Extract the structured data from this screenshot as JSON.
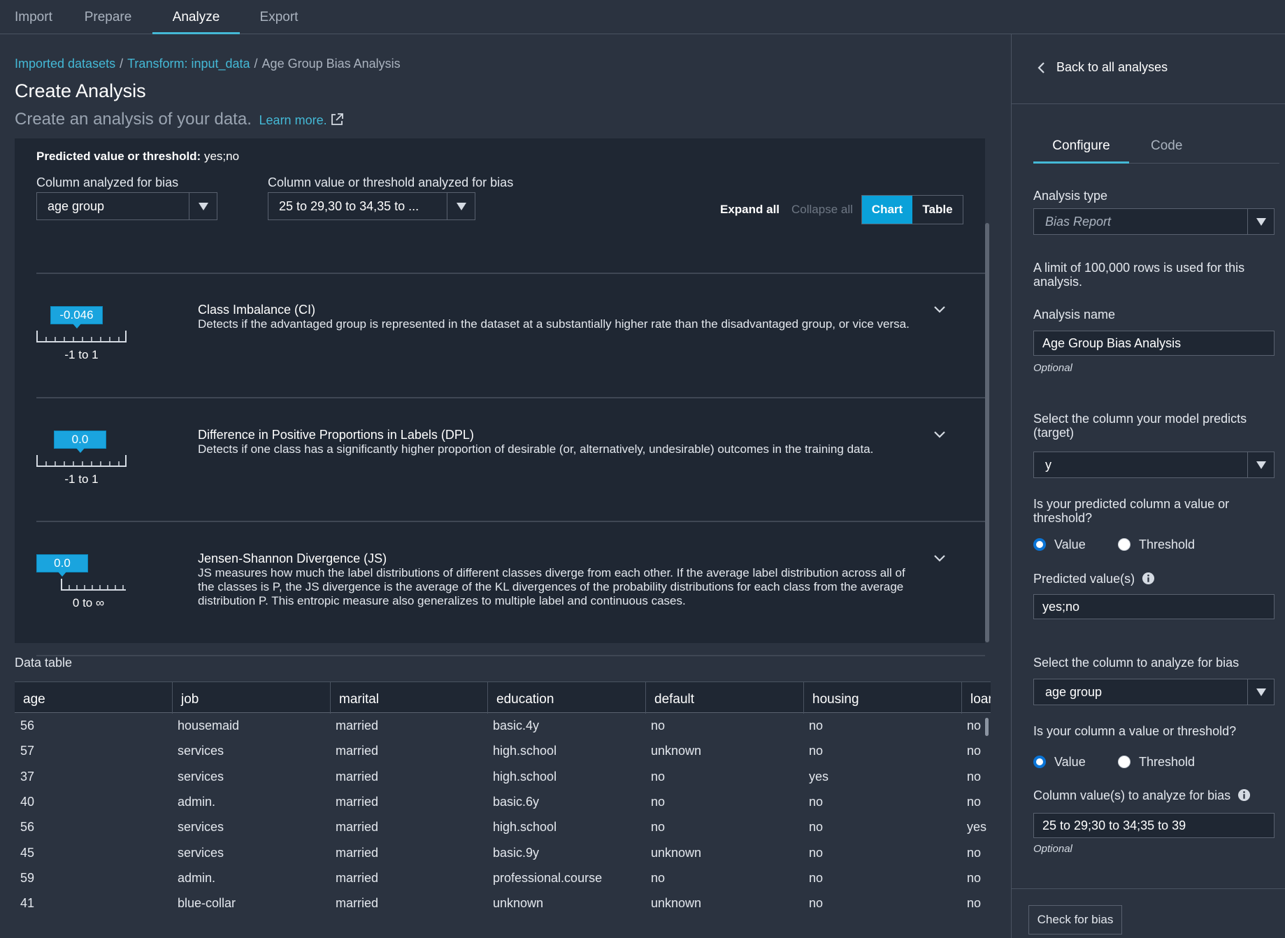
{
  "nav": {
    "tabs": [
      {
        "label": "Import"
      },
      {
        "label": "Prepare"
      },
      {
        "label": "Analyze"
      },
      {
        "label": "Export"
      }
    ]
  },
  "breadcrumb": {
    "items": [
      "Imported datasets",
      "Transform: input_data",
      "Age Group Bias Analysis"
    ]
  },
  "page": {
    "title": "Create Analysis",
    "subtitle": "Create an analysis of your data.",
    "learn_more": "Learn more."
  },
  "report": {
    "predicted_label": "Predicted value or threshold:",
    "predicted_value": "yes;no",
    "column_label": "Column analyzed for bias",
    "column_value": "age group",
    "threshold_label": "Column value or threshold analyzed for bias",
    "threshold_value": "25 to 29,30 to 34,35 to ...",
    "expand_all": "Expand all",
    "collapse_all": "Collapse all",
    "view_chart": "Chart",
    "view_table": "Table",
    "metrics": [
      {
        "name": "Class Imbalance (CI)",
        "description": "Detects if the advantaged group is represented in the dataset at a substantially higher rate than the disadvantaged group, or vice versa.",
        "value": "-0.046",
        "range": "-1 to 1"
      },
      {
        "name": "Difference in Positive Proportions in Labels (DPL)",
        "description": "Detects if one class has a significantly higher proportion of desirable (or, alternatively, undesirable) outcomes in the training data.",
        "value": "0.0",
        "range": "-1 to 1"
      },
      {
        "name": "Jensen-Shannon Divergence (JS)",
        "description": "JS measures how much the label distributions of different classes diverge from each other. If the average label distribution across all of the classes is P, the JS divergence is the average of the KL divergences of the probability distributions for each class from the average distribution P. This entropic measure also generalizes to multiple label and continuous cases.",
        "value": "0.0",
        "range": "0 to ∞"
      }
    ]
  },
  "data_table": {
    "title": "Data table",
    "columns": [
      "age",
      "job",
      "marital",
      "education",
      "default",
      "housing",
      "loan"
    ],
    "rows": [
      [
        "56",
        "housemaid",
        "married",
        "basic.4y",
        "no",
        "no",
        "no"
      ],
      [
        "57",
        "services",
        "married",
        "high.school",
        "unknown",
        "no",
        "no"
      ],
      [
        "37",
        "services",
        "married",
        "high.school",
        "no",
        "yes",
        "no"
      ],
      [
        "40",
        "admin.",
        "married",
        "basic.6y",
        "no",
        "no",
        "no"
      ],
      [
        "56",
        "services",
        "married",
        "high.school",
        "no",
        "no",
        "yes"
      ],
      [
        "45",
        "services",
        "married",
        "basic.9y",
        "unknown",
        "no",
        "no"
      ],
      [
        "59",
        "admin.",
        "married",
        "professional.course",
        "no",
        "no",
        "no"
      ],
      [
        "41",
        "blue-collar",
        "married",
        "unknown",
        "unknown",
        "no",
        "no"
      ]
    ]
  },
  "side": {
    "back": "Back to all analyses",
    "tab_configure": "Configure",
    "tab_code": "Code",
    "analysis_type_label": "Analysis type",
    "analysis_type_value": "Bias Report",
    "limit_note": "A limit of 100,000 rows is used for this analysis.",
    "analysis_name_label": "Analysis name",
    "analysis_name_value": "Age Group Bias Analysis",
    "optional": "Optional",
    "target_label": "Select the column your model predicts (target)",
    "target_value": "y",
    "pred_kind_label": "Is your predicted column a value or threshold?",
    "radio_value": "Value",
    "radio_threshold": "Threshold",
    "predicted_values_label": "Predicted value(s)",
    "predicted_values_value": "yes;no",
    "bias_column_label": "Select the column to analyze for bias",
    "bias_column_value": "age group",
    "bias_kind_label": "Is your column a value or threshold?",
    "bias_values_label": "Column value(s) to analyze for bias",
    "bias_values_value": "25 to 29;30 to 34;35 to 39",
    "check_button": "Check for bias"
  },
  "colors": {
    "accent": "#44b9d6",
    "toggle_active": "#0aa1d9",
    "panel_bg": "#1f2733",
    "page_bg": "#2b3340"
  }
}
